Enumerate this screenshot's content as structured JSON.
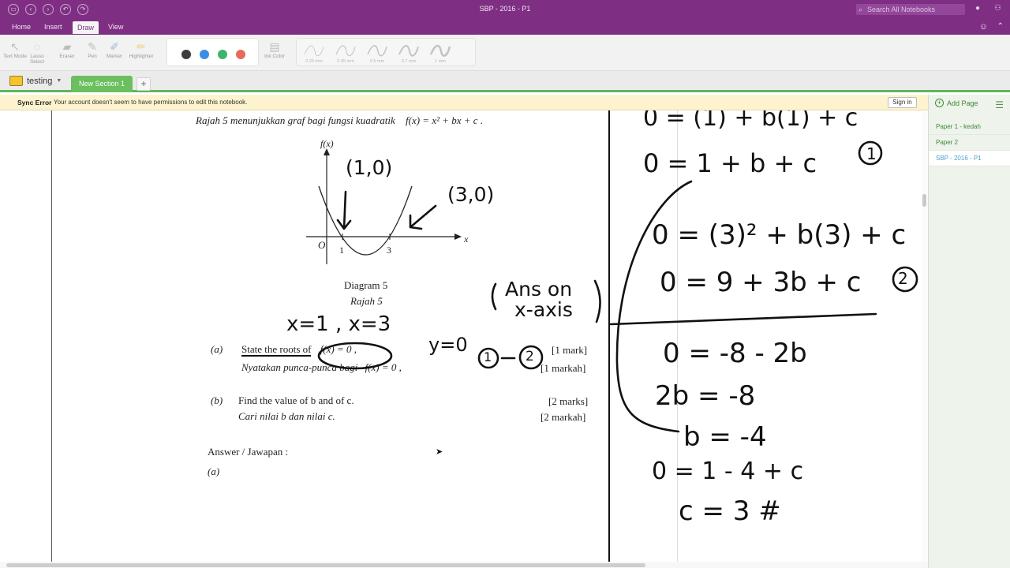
{
  "window": {
    "title": "SBP - 2016 - P1"
  },
  "toolbar_icons": [
    "folder-icon",
    "back-icon",
    "forward-icon",
    "undo-icon",
    "redo-icon"
  ],
  "search": {
    "placeholder": "Search All Notebooks"
  },
  "menu": {
    "tabs": [
      "Home",
      "Insert",
      "Draw",
      "View"
    ],
    "active": "Draw"
  },
  "ribbon": {
    "tools": [
      "Text Mode",
      "Lasso Select",
      "Eraser",
      "Pen",
      "Marker",
      "Highlighter"
    ],
    "colors": [
      "#3d3d3d",
      "#3b8de6",
      "#3db46d",
      "#e96a5a"
    ],
    "ink_color_label": "Ink Color",
    "pen_sizes": [
      "0.25 mm",
      "0.35 mm",
      "0.5 mm",
      "0.7 mm",
      "1 mm"
    ]
  },
  "notebook": {
    "name": "testing",
    "active_section": "New Section 1",
    "add_section": "+"
  },
  "sync": {
    "label": "Sync Error",
    "message": "Your account doesn't seem to have permissions to edit this notebook.",
    "button": "Sign in"
  },
  "sidebar": {
    "add_page": "Add Page",
    "pages": [
      "Paper 1 - kedah",
      "Paper 2",
      "SBP - 2016 - P1"
    ],
    "selected_index": 2
  },
  "document": {
    "intro": "Rajah 5 menunjukkan graf bagi fungsi kuadratik",
    "intro_formula": "f(x) = x² + bx + c .",
    "graph_fx": "f(x)",
    "graph_x": "x",
    "graph_o": "O",
    "graph_tick1": "1",
    "graph_tick3": "3",
    "diagram_en": "Diagram 5",
    "diagram_my": "Rajah 5",
    "a_label": "(a)",
    "a_en": "State the roots of",
    "a_en_formula": "f(x) = 0 ,",
    "a_marks_en": "[1 mark]",
    "a_my": "Nyatakan punca-punca bagi",
    "a_my_formula": "f(x) = 0 ,",
    "a_marks_my": "[1 markah]",
    "b_label": "(b)",
    "b_en": "Find the value of b and of c.",
    "b_marks_en": "[2 marks]",
    "b_my": "Cari nilai b dan nilai c.",
    "b_marks_my": "[2 markah]",
    "answer": "Answer / Jawapan :",
    "answer_a": "(a)"
  },
  "handwriting": {
    "pt1": "(1,0)",
    "pt3": "(3,0)",
    "ans_on": "Ans on",
    "x_axis": "x-axis",
    "roots": "x=1 , x=3",
    "y0": "y=0",
    "one": "1",
    "two": "2",
    "eq0": "0 = (1) + b(1) + c",
    "eq1": "0 = 1 + b + c",
    "eq2": "0 = (3)² + b(3) + c",
    "eq2b": "0 = 9 + 3b + c",
    "eq3": "0 = -8 - 2b",
    "eq4": "2b = -8",
    "eq5": "b = -4",
    "eq6": "0 = 1 - 4 + c",
    "eq7": "c = 3 #"
  }
}
